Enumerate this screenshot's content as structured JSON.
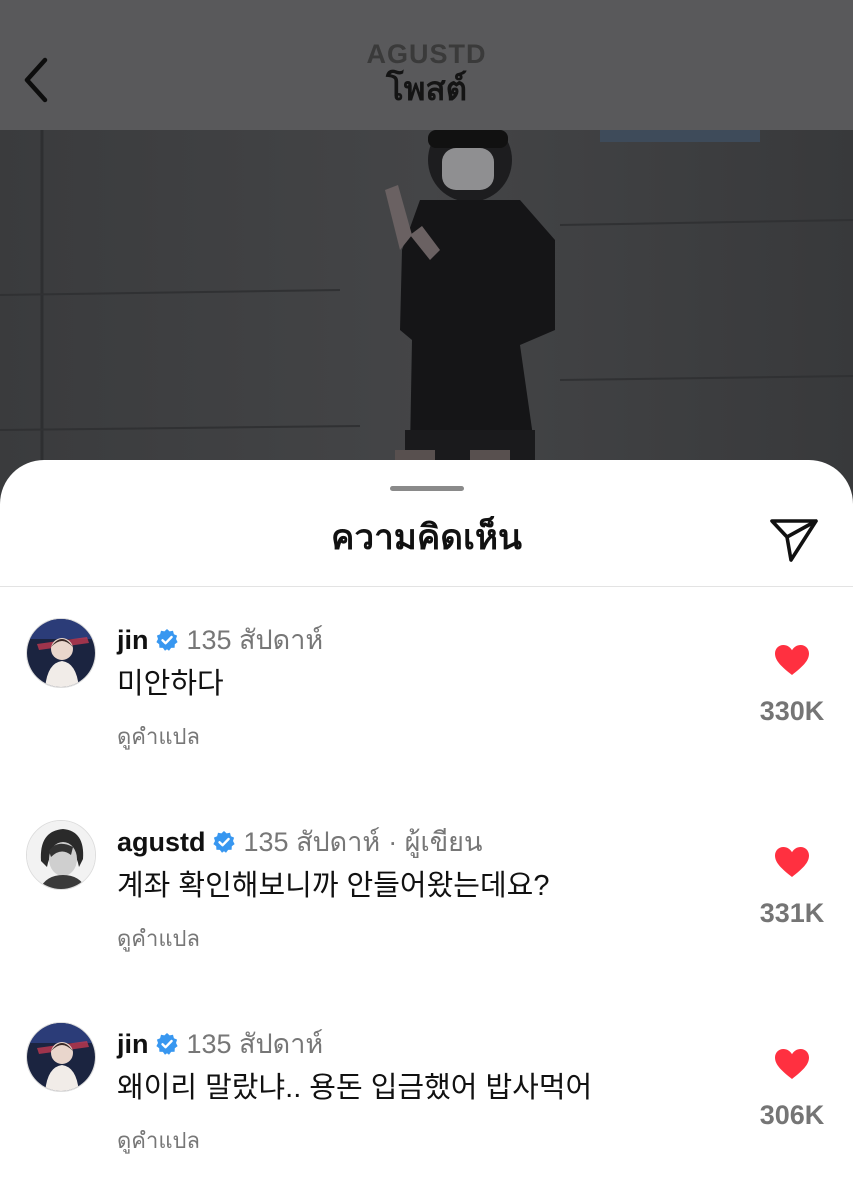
{
  "header": {
    "username": "AGUSTD",
    "title": "โพสต์"
  },
  "sheet": {
    "title": "ความคิดเห็น"
  },
  "comments": [
    {
      "username": "jin",
      "time": "135 สัปดาห์",
      "author_tag": "",
      "text": "미안하다",
      "translate": "ดูคำแปล",
      "likes": "330K"
    },
    {
      "username": "agustd",
      "time": "135 สัปดาห์",
      "author_tag": "· ผู้เขียน",
      "text": "계좌 확인해보니까 안들어왔는데요?",
      "translate": "ดูคำแปล",
      "likes": "331K"
    },
    {
      "username": "jin",
      "time": "135 สัปดาห์",
      "author_tag": "",
      "text": "왜이리 말랐냐.. 용돈 입금했어 밥사먹어",
      "translate": "ดูคำแปล",
      "likes": "306K"
    }
  ],
  "icons": {
    "back": "chevron-left-icon",
    "share": "paper-plane-icon",
    "verified": "verified-badge-icon",
    "like": "heart-icon"
  },
  "colors": {
    "verified": "#3897f0",
    "heart": "#ff3040",
    "dim_overlay": "#59595b"
  }
}
